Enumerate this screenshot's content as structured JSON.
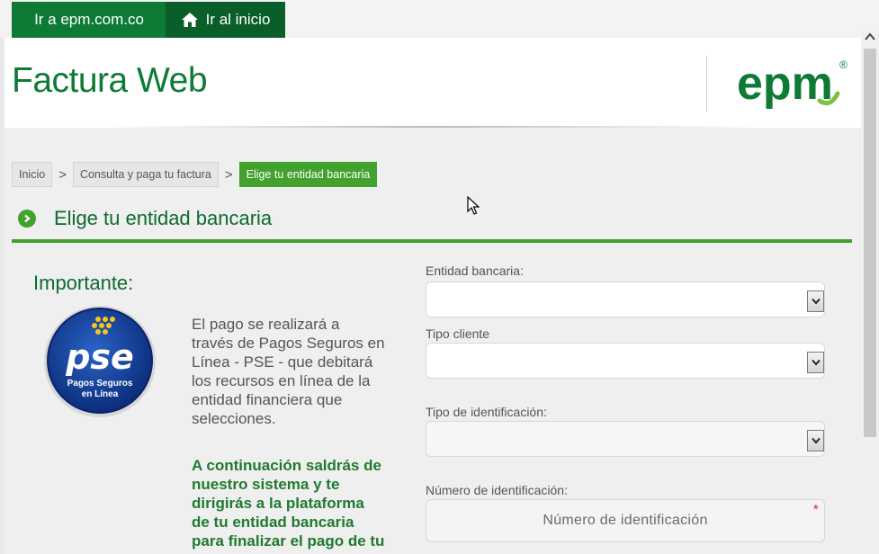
{
  "topnav": {
    "epm_link": "Ir a epm.com.co",
    "home_link": "Ir al inicio"
  },
  "header": {
    "title": "Factura Web",
    "logo_text": "epm",
    "logo_mark": "®"
  },
  "breadcrumb": {
    "items": [
      "Inicio",
      "Consulta y paga tu factura",
      "Elige tu entidad bancaria"
    ],
    "separator": ">"
  },
  "section": {
    "title": "Elige tu entidad bancaria"
  },
  "info": {
    "heading": "Importante:",
    "pse_logo": {
      "big": "pse",
      "line1": "Pagos Seguros",
      "line2": "en Línea"
    },
    "paragraph1": "El pago se realizará a través de Pagos Seguros en Línea - PSE - que debitará los recursos en línea de la entidad financiera que selecciones.",
    "paragraph2": "A continuación saldrás de nuestro sistema y te dirigirás a la plataforma de tu entidad bancaria para finalizar el pago de tu factura."
  },
  "form": {
    "entidad_label": "Entidad bancaria:",
    "entidad_value": "",
    "tipo_cliente_label": "Tipo cliente",
    "tipo_cliente_value": "",
    "tipo_id_label": "Tipo de identificación:",
    "tipo_id_value": "",
    "numero_label": "Número de identificación:",
    "numero_placeholder": "Número de identificación",
    "required_mark": "*"
  },
  "colors": {
    "brand_green": "#0d7a35",
    "dark_green": "#0a5e2a",
    "accent_green": "#43a12d",
    "required_red": "#d0282e"
  }
}
